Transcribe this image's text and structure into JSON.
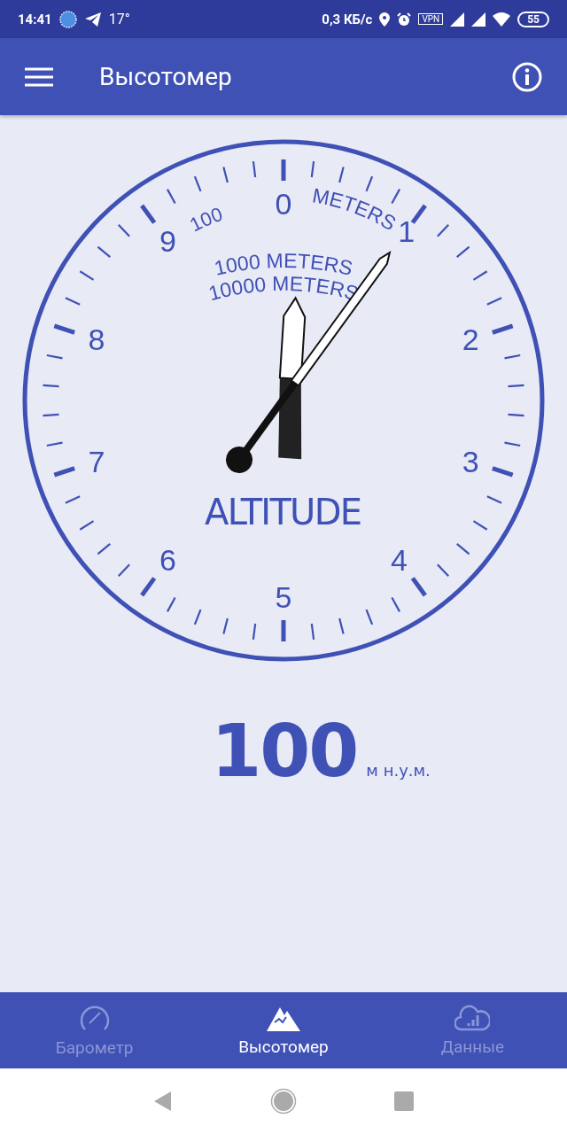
{
  "status_bar": {
    "time": "14:41",
    "temperature": "17°",
    "speed": "0,3 КБ/с",
    "vpn": "VPN",
    "battery": "55"
  },
  "app_bar": {
    "title": "Высотомер"
  },
  "gauge": {
    "numerals": [
      "0",
      "1",
      "2",
      "3",
      "4",
      "5",
      "6",
      "7",
      "8",
      "9"
    ],
    "scale_label": "100",
    "unit_label": "METERS",
    "inner_labels": [
      "1000 METERS",
      "10000 METERS"
    ],
    "caption": "ALTITUDE",
    "hands": [
      {
        "kind": "short"
      },
      {
        "kind": "long"
      }
    ]
  },
  "reading": {
    "value": "100",
    "unit": "м н.у.м."
  },
  "bottom_nav": [
    {
      "kind": "gauge",
      "label": "Барометр",
      "selected": false
    },
    {
      "kind": "mountain",
      "label": "Высотомер",
      "selected": true
    },
    {
      "kind": "cloud",
      "label": "Данные",
      "selected": false
    }
  ]
}
